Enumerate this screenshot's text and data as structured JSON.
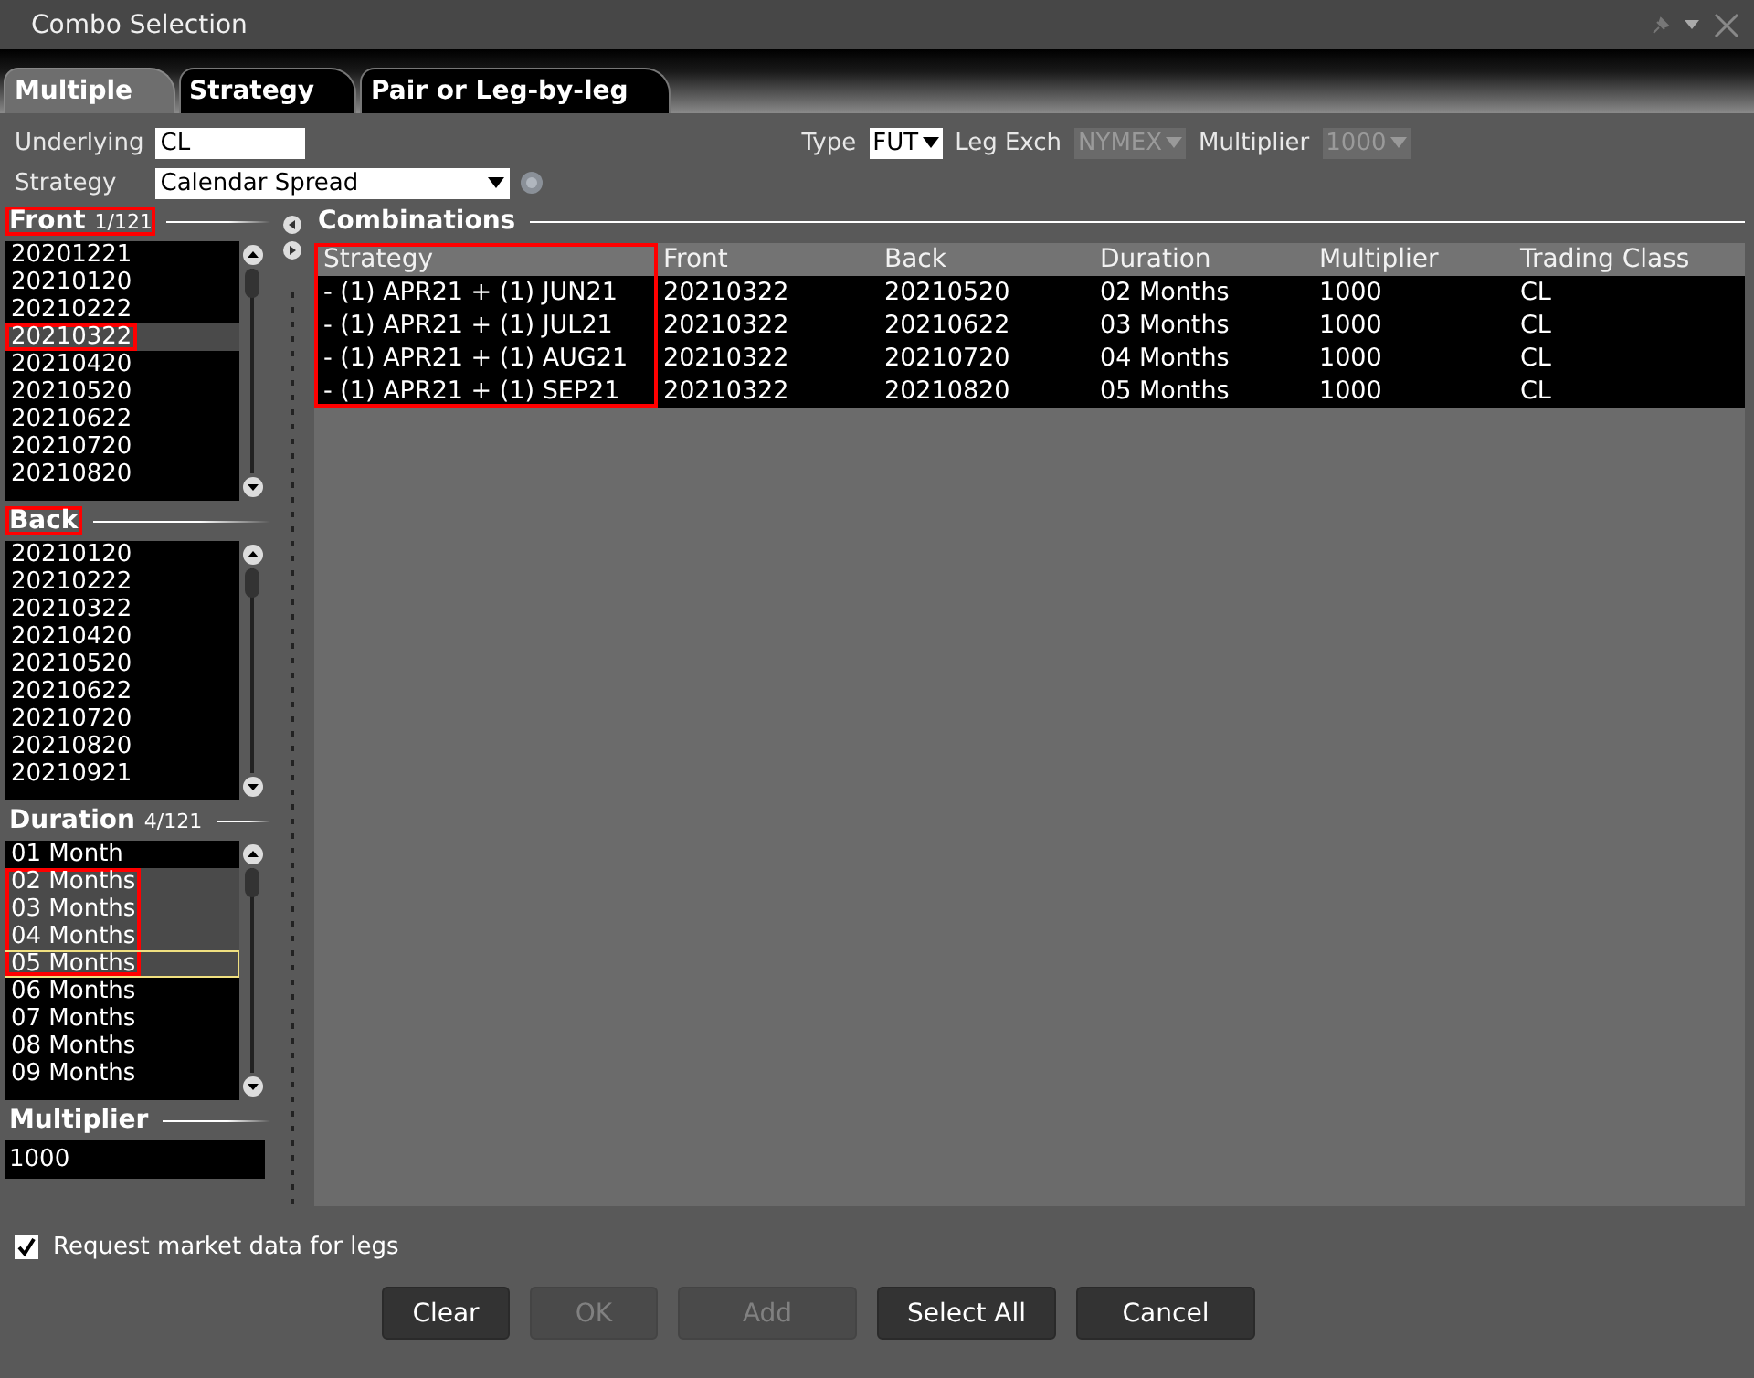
{
  "window": {
    "title": "Combo Selection"
  },
  "tabs": [
    {
      "label": "Multiple",
      "selected": true
    },
    {
      "label": "Strategy",
      "selected": false
    },
    {
      "label": "Pair or Leg-by-leg",
      "selected": false
    }
  ],
  "form": {
    "underlying_label": "Underlying",
    "underlying": "CL",
    "strategy_label": "Strategy",
    "strategy": "Calendar Spread",
    "dropdowns": [
      {
        "label": "Type",
        "value": "FUT",
        "disabled": false
      },
      {
        "label": "Leg Exch",
        "value": "NYMEX",
        "disabled": true
      },
      {
        "label": "Multiplier",
        "value": "1000",
        "disabled": true
      }
    ]
  },
  "lists": [
    {
      "title": "Front",
      "count": "1/121",
      "highlighted": true,
      "items": [
        {
          "text": "20201221",
          "selected": false,
          "highlighted": false
        },
        {
          "text": "20210120",
          "selected": false,
          "highlighted": false
        },
        {
          "text": "20210222",
          "selected": false,
          "highlighted": false
        },
        {
          "text": "20210322",
          "selected": true,
          "highlighted": true
        },
        {
          "text": "20210420",
          "selected": false,
          "highlighted": false
        },
        {
          "text": "20210520",
          "selected": false,
          "highlighted": false
        },
        {
          "text": "20210622",
          "selected": false,
          "highlighted": false
        },
        {
          "text": "20210720",
          "selected": false,
          "highlighted": false
        },
        {
          "text": "20210820",
          "selected": false,
          "highlighted": false
        }
      ]
    },
    {
      "title": "Back",
      "highlighted": true,
      "items": [
        {
          "text": "20210120",
          "selected": false,
          "highlighted": false
        },
        {
          "text": "20210222",
          "selected": false,
          "highlighted": false
        },
        {
          "text": "20210322",
          "selected": false,
          "highlighted": false
        },
        {
          "text": "20210420",
          "selected": false,
          "highlighted": false
        },
        {
          "text": "20210520",
          "selected": false,
          "highlighted": false
        },
        {
          "text": "20210622",
          "selected": false,
          "highlighted": false
        },
        {
          "text": "20210720",
          "selected": false,
          "highlighted": false
        },
        {
          "text": "20210820",
          "selected": false,
          "highlighted": false
        },
        {
          "text": "20210921",
          "selected": false,
          "highlighted": false
        }
      ]
    },
    {
      "title": "Duration",
      "count": "4/121",
      "highlighted": false,
      "items": [
        {
          "text": "01 Month",
          "selected": false,
          "highlighted": false,
          "focused": false
        },
        {
          "text": "02 Months",
          "selected": true,
          "highlighted": true,
          "focused": false
        },
        {
          "text": "03 Months",
          "selected": true,
          "highlighted": true,
          "focused": false
        },
        {
          "text": "04 Months",
          "selected": true,
          "highlighted": true,
          "focused": false
        },
        {
          "text": "05 Months",
          "selected": true,
          "highlighted": true,
          "focused": true
        },
        {
          "text": "06 Months",
          "selected": false,
          "highlighted": false,
          "focused": false
        },
        {
          "text": "07 Months",
          "selected": false,
          "highlighted": false,
          "focused": false
        },
        {
          "text": "08 Months",
          "selected": false,
          "highlighted": false,
          "focused": false
        },
        {
          "text": "09 Months",
          "selected": false,
          "highlighted": false,
          "focused": false
        }
      ]
    }
  ],
  "multiplier": {
    "title": "Multiplier",
    "value": "1000"
  },
  "combinations": {
    "title": "Combinations",
    "columns": [
      {
        "label": "Strategy",
        "highlighted": true
      },
      {
        "label": "Front",
        "highlighted": false
      },
      {
        "label": "Back",
        "highlighted": false
      },
      {
        "label": "Duration",
        "highlighted": false
      },
      {
        "label": "Multiplier",
        "highlighted": false
      },
      {
        "label": "Trading Class",
        "highlighted": false
      }
    ],
    "rows": [
      [
        "- (1) APR21 + (1) JUN21",
        "20210322",
        "20210520",
        "02 Months",
        "1000",
        "CL"
      ],
      [
        "- (1) APR21 + (1) JUL21",
        "20210322",
        "20210622",
        "03 Months",
        "1000",
        "CL"
      ],
      [
        "- (1) APR21 + (1) AUG21",
        "20210322",
        "20210720",
        "04 Months",
        "1000",
        "CL"
      ],
      [
        "- (1) APR21 + (1) SEP21",
        "20210322",
        "20210820",
        "05 Months",
        "1000",
        "CL"
      ]
    ]
  },
  "request_market_data": {
    "label": "Request market data for legs",
    "checked": true
  },
  "buttons": [
    {
      "label": "Clear",
      "disabled": false
    },
    {
      "label": "OK",
      "disabled": true
    },
    {
      "label": "Add",
      "disabled": true
    },
    {
      "label": "Select All",
      "disabled": false
    },
    {
      "label": "Cancel",
      "disabled": false
    }
  ]
}
